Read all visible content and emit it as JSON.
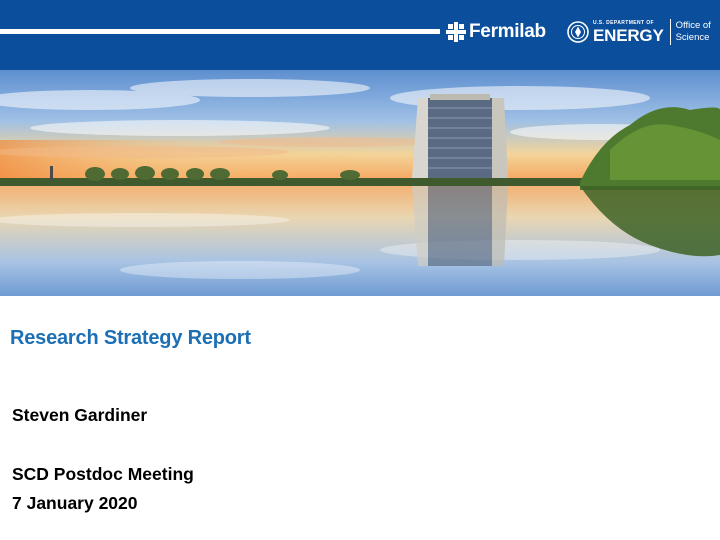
{
  "header": {
    "lab_name": "Fermilab",
    "lab_icon": "fermilab-emblem-icon",
    "doe_department": "U.S. DEPARTMENT OF",
    "doe_name": "ENERGY",
    "doe_icon": "doe-seal-icon",
    "doe_office_line1": "Office of",
    "doe_office_line2": "Science",
    "bar_color": "#0b4e9c"
  },
  "hero_image": {
    "description_icon": "wilson-hall-reflection-photo"
  },
  "slide": {
    "title": "Research Strategy Report",
    "title_color": "#1d6fb5",
    "presenter": "Steven Gardiner",
    "meeting": "SCD Postdoc Meeting",
    "date": "7 January 2020"
  }
}
